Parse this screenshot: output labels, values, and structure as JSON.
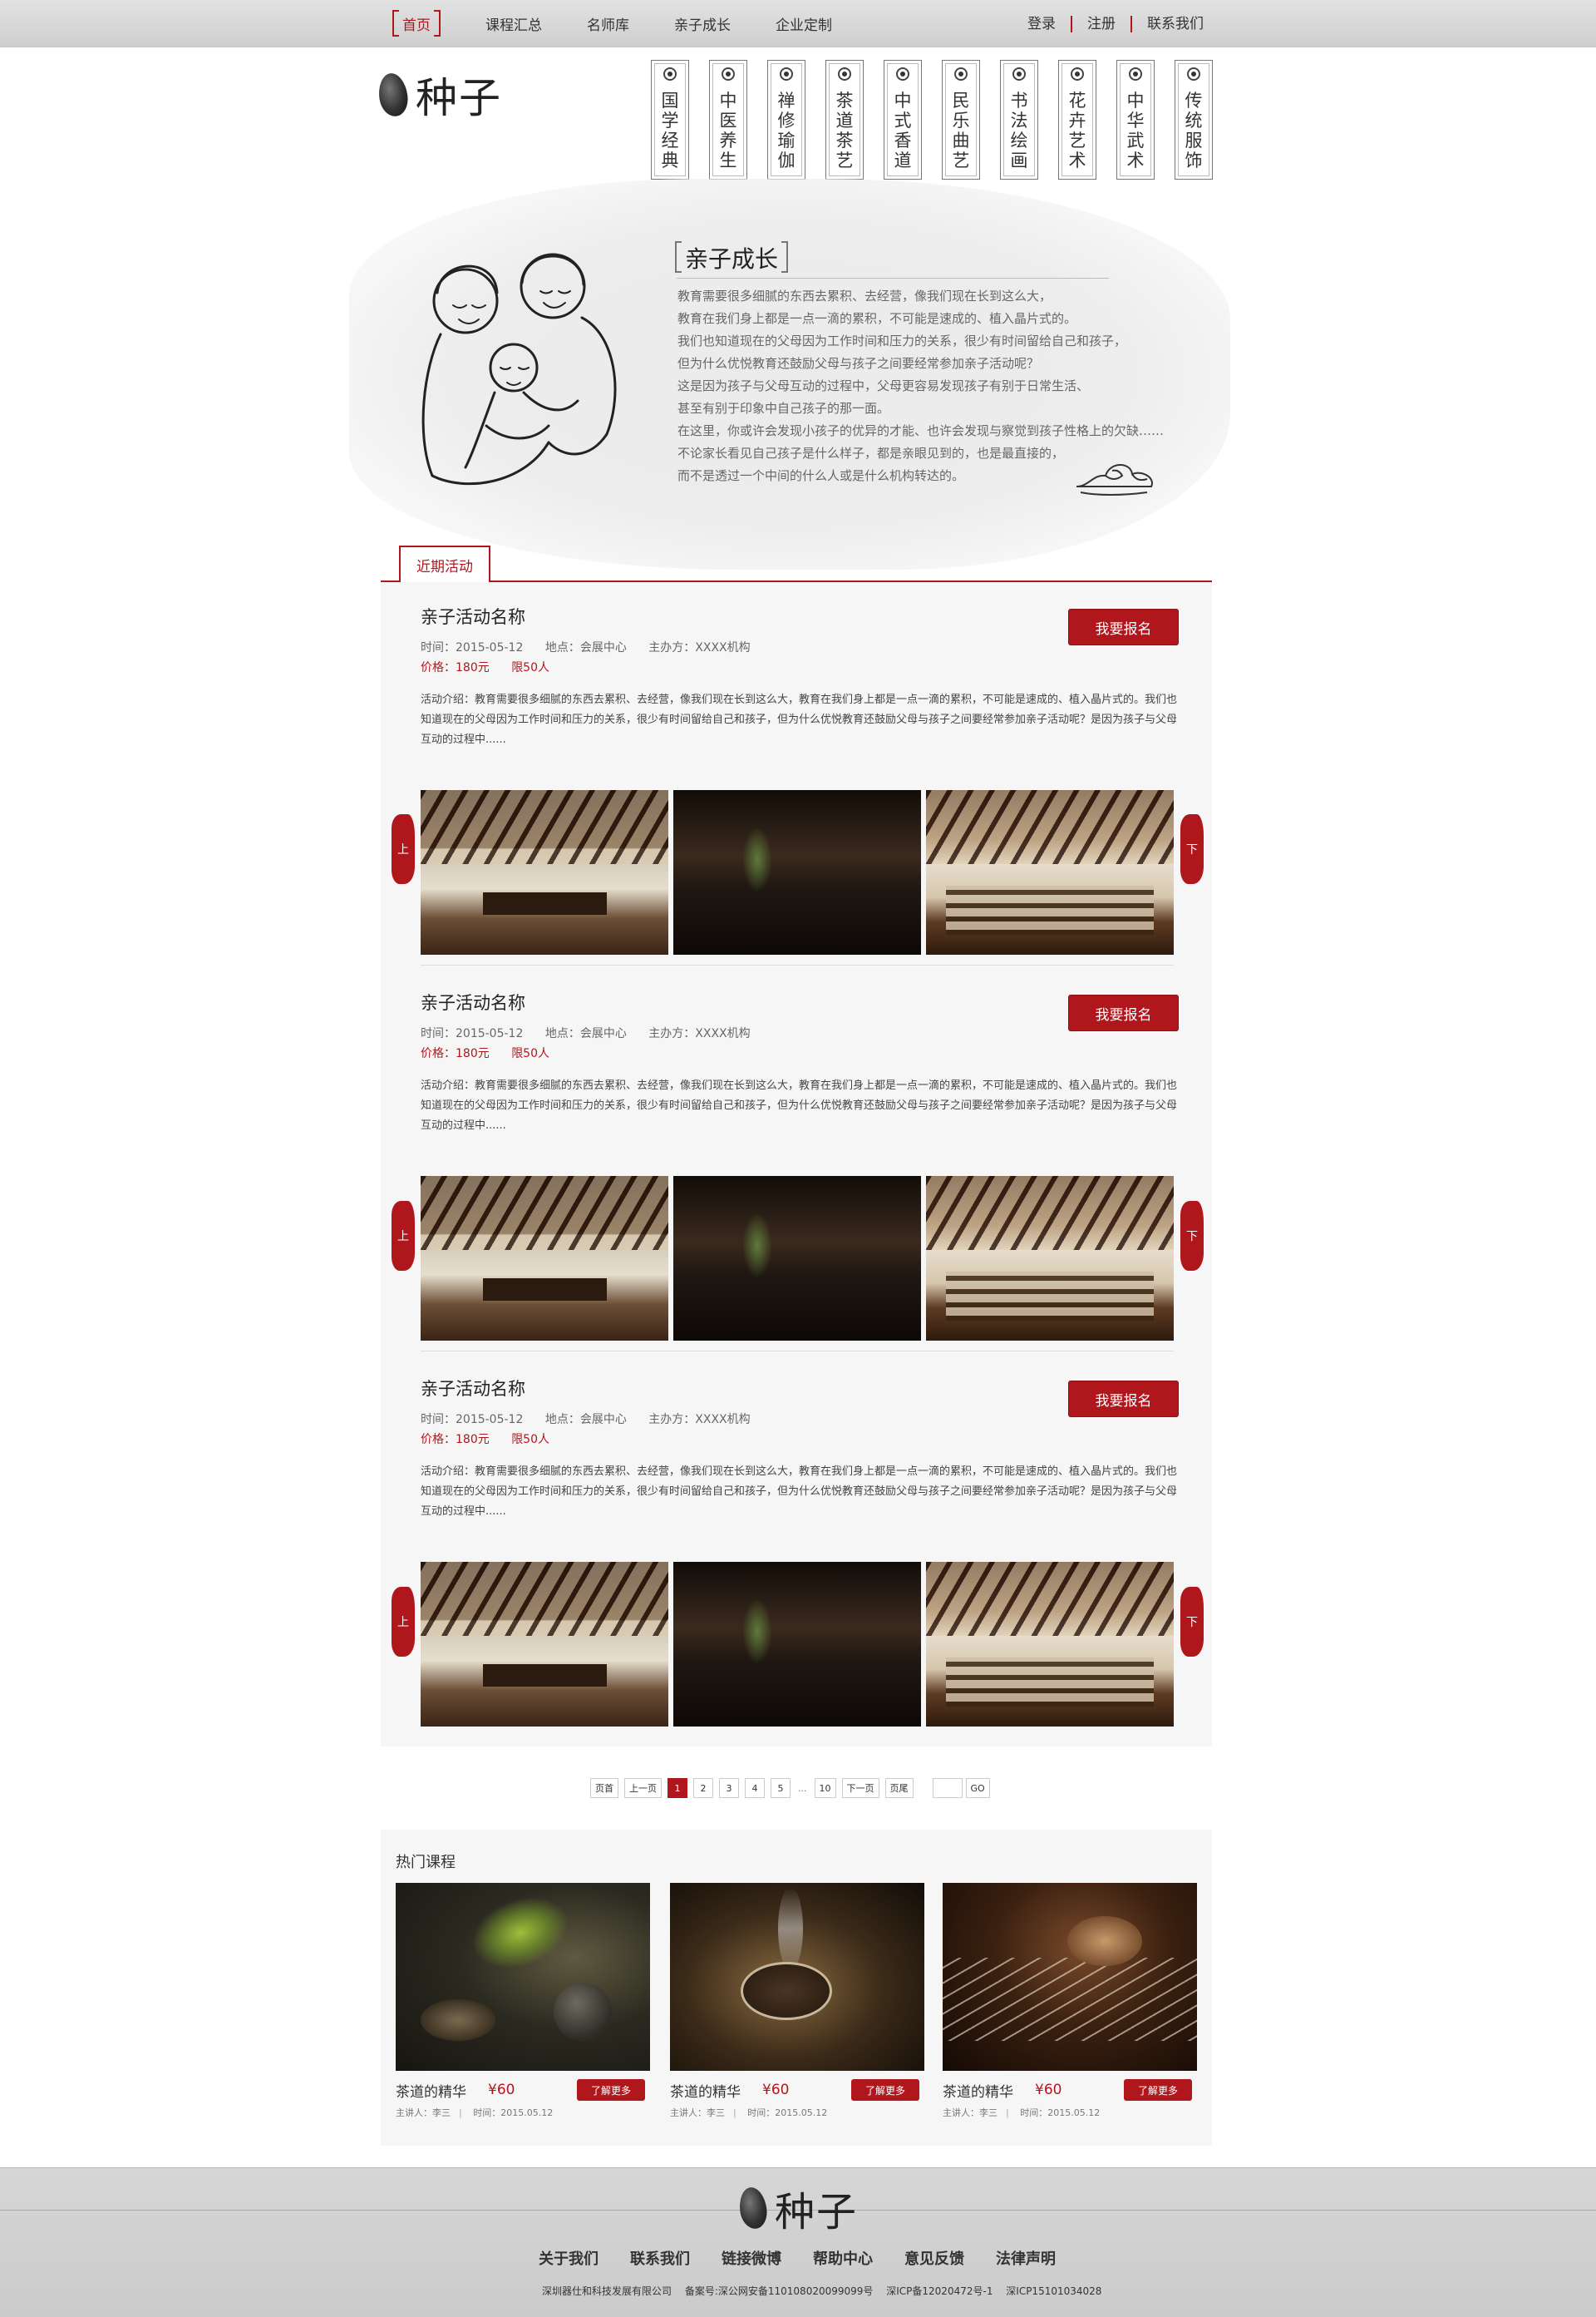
{
  "topnav": {
    "items": [
      "首页",
      "课程汇总",
      "名师库",
      "亲子成长",
      "企业定制"
    ],
    "links": [
      "登录",
      "注册",
      "联系我们"
    ]
  },
  "logo": {
    "text": "种子"
  },
  "categories": [
    "国学经典",
    "中医养生",
    "禅修瑜伽",
    "茶道茶艺",
    "中式香道",
    "民乐曲艺",
    "书法绘画",
    "花卉艺术",
    "中华武术",
    "传统服饰"
  ],
  "intro": {
    "title": "亲子成长",
    "lines": [
      "教育需要很多细腻的东西去累积、去经营，像我们现在长到这么大，",
      "教育在我们身上都是一点一滴的累积，不可能是速成的、植入晶片式的。",
      "我们也知道现在的父母因为工作时间和压力的关系，很少有时间留给自己和孩子，",
      "但为什么优悦教育还鼓励父母与孩子之间要经常参加亲子活动呢？",
      "这是因为孩子与父母互动的过程中，父母更容易发现孩子有别于日常生活、",
      "甚至有别于印象中自己孩子的那一面。",
      "在这里，你或许会发现小孩子的优异的才能、也许会发现与察觉到孩子性格上的欠缺……",
      "不论家长看见自己孩子是什么样子，都是亲眼见到的，也是最直接的，",
      "而不是透过一个中间的什么人或是什么机构转达的。"
    ]
  },
  "activities": {
    "tab": "近期活动",
    "events": [
      {
        "title": "亲子活动名称",
        "time": "时间：2015-05-12",
        "place": "地点：会展中心",
        "organizer": "主办方：XXXX机构",
        "price": "价格：180元",
        "limit": "限50人",
        "desc": "活动介绍：教育需要很多细腻的东西去累积、去经营，像我们现在长到这么大，教育在我们身上都是一点一滴的累积，不可能是速成的、植入晶片式的。我们也知道现在的父母因为工作时间和压力的关系，很少有时间留给自己和孩子，但为什么优悦教育还鼓励父母与孩子之间要经常参加亲子活动呢？是因为孩子与父母互动的过程中......",
        "signup": "我要报名"
      },
      {
        "title": "亲子活动名称",
        "time": "时间：2015-05-12",
        "place": "地点：会展中心",
        "organizer": "主办方：XXXX机构",
        "price": "价格：180元",
        "limit": "限50人",
        "desc": "活动介绍：教育需要很多细腻的东西去累积、去经营，像我们现在长到这么大，教育在我们身上都是一点一滴的累积，不可能是速成的、植入晶片式的。我们也知道现在的父母因为工作时间和压力的关系，很少有时间留给自己和孩子，但为什么优悦教育还鼓励父母与孩子之间要经常参加亲子活动呢？是因为孩子与父母互动的过程中......",
        "signup": "我要报名"
      },
      {
        "title": "亲子活动名称",
        "time": "时间：2015-05-12",
        "place": "地点：会展中心",
        "organizer": "主办方：XXXX机构",
        "price": "价格：180元",
        "limit": "限50人",
        "desc": "活动介绍：教育需要很多细腻的东西去累积、去经营，像我们现在长到这么大，教育在我们身上都是一点一滴的累积，不可能是速成的、植入晶片式的。我们也知道现在的父母因为工作时间和压力的关系，很少有时间留给自己和孩子，但为什么优悦教育还鼓励父母与孩子之间要经常参加亲子活动呢？是因为孩子与父母互动的过程中......",
        "signup": "我要报名"
      }
    ],
    "prev_label": "上",
    "next_label": "下"
  },
  "pagination": {
    "first": "页首",
    "prev": "上一页",
    "pages": [
      "1",
      "2",
      "3",
      "4",
      "5"
    ],
    "ellipsis": "...",
    "last_page": "10",
    "next": "下一页",
    "last": "页尾",
    "go": "GO",
    "current": "1"
  },
  "hot_courses": {
    "title": "热门课程",
    "items": [
      {
        "name": "茶道的精华",
        "price": "¥60",
        "more": "了解更多",
        "lecturer": "主讲人：李三",
        "time": "时间：2015.05.12"
      },
      {
        "name": "茶道的精华",
        "price": "¥60",
        "more": "了解更多",
        "lecturer": "主讲人：李三",
        "time": "时间：2015.05.12"
      },
      {
        "name": "茶道的精华",
        "price": "¥60",
        "more": "了解更多",
        "lecturer": "主讲人：李三",
        "time": "时间：2015.05.12"
      }
    ]
  },
  "footer": {
    "logo_text": "种子",
    "links": [
      "关于我们",
      "联系我们",
      "链接微博",
      "帮助中心",
      "意见反馈",
      "法律声明"
    ],
    "company": "深圳器仕和科技发展有限公司",
    "beian": "备案号:深公网安备110108020099099号",
    "icp1": "深ICP备12020472号-1",
    "icp2": "深ICP15101034028"
  },
  "colors": {
    "accent": "#b0171d",
    "panel": "#f6f6f6"
  }
}
